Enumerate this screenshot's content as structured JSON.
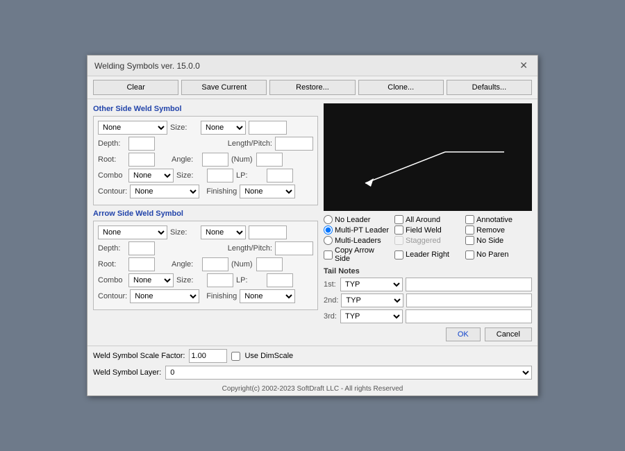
{
  "dialog": {
    "title": "Welding Symbols ver. 15.0.0",
    "close_label": "✕"
  },
  "toolbar": {
    "clear": "Clear",
    "save_current": "Save Current",
    "restore": "Restore...",
    "clone": "Clone...",
    "defaults": "Defaults..."
  },
  "other_side": {
    "label": "Other Side Weld Symbol",
    "weld_type": "None",
    "size_label": "Size:",
    "size_val": "None",
    "depth_label": "Depth:",
    "length_pitch_label": "Length/Pitch:",
    "root_label": "Root:",
    "angle_label": "Angle:",
    "num_label": "(Num)",
    "combo_label": "Combo",
    "combo_val": "None",
    "size2_label": "Size:",
    "lp_label": "LP:",
    "contour_label": "Contour:",
    "contour_val": "None",
    "finishing_label": "Finishing",
    "finishing_val": "None"
  },
  "arrow_side": {
    "label": "Arrow Side Weld Symbol",
    "weld_type": "None",
    "size_label": "Size:",
    "size_val": "None",
    "depth_label": "Depth:",
    "length_pitch_label": "Length/Pitch:",
    "root_label": "Root:",
    "angle_label": "Angle:",
    "num_label": "(Num)",
    "combo_label": "Combo",
    "combo_val": "None",
    "size2_label": "Size:",
    "lp_label": "LP:",
    "contour_label": "Contour:",
    "contour_val": "None",
    "finishing_label": "Finishing",
    "finishing_val": "None"
  },
  "options": {
    "no_leader": "No Leader",
    "all_around": "All Around",
    "annotative": "Annotative",
    "multi_pt_leader": "Multi-PT Leader",
    "field_weld": "Field Weld",
    "remove": "Remove",
    "multi_leaders": "Multi-Leaders",
    "staggered": "Staggered",
    "no_side": "No Side",
    "copy_arrow_side": "Copy Arrow Side",
    "leader_right": "Leader Right",
    "no_paren": "No Paren"
  },
  "tail_notes": {
    "label": "Tail Notes",
    "first_label": "1st:",
    "first_val": "TYP",
    "second_label": "2nd:",
    "second_val": "TYP",
    "third_label": "3rd:",
    "third_val": "TYP"
  },
  "scale": {
    "label": "Weld Symbol Scale Factor:",
    "value": "1.00",
    "use_dimscale": "Use DimScale"
  },
  "layer": {
    "label": "Weld Symbol Layer:",
    "value": "0"
  },
  "buttons": {
    "ok": "OK",
    "cancel": "Cancel"
  },
  "copyright": "Copyright(c) 2002-2023 SoftDraft LLC - All rights Reserved"
}
